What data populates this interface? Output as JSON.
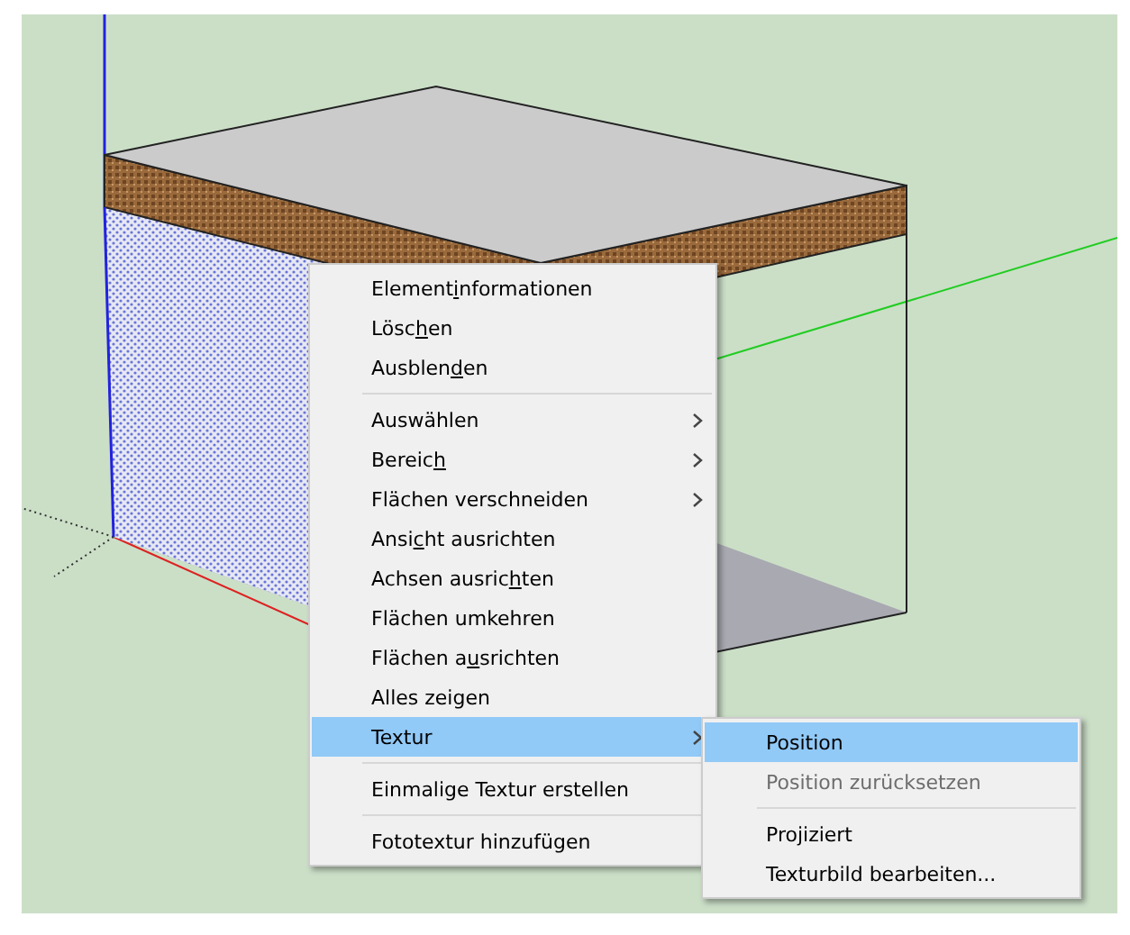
{
  "context_menu": {
    "items": [
      {
        "kind": "item",
        "label_before": "Element",
        "access_key": "i",
        "label_after": "nformationen",
        "has_submenu": false,
        "selected": false
      },
      {
        "kind": "item",
        "label_before": "Lösc",
        "access_key": "h",
        "label_after": "en",
        "has_submenu": false,
        "selected": false
      },
      {
        "kind": "item",
        "label_before": "Ausblen",
        "access_key": "d",
        "label_after": "en",
        "has_submenu": false,
        "selected": false
      },
      {
        "kind": "separator"
      },
      {
        "kind": "item",
        "label": "Auswählen",
        "has_submenu": true,
        "selected": false
      },
      {
        "kind": "item",
        "label_before": "Bereic",
        "access_key": "h",
        "has_submenu": true,
        "selected": false
      },
      {
        "kind": "item",
        "label": "Flächen verschneiden",
        "has_submenu": true,
        "selected": false
      },
      {
        "kind": "item",
        "label_before": "Ansi",
        "access_key": "c",
        "label_after": "ht ausrichten",
        "has_submenu": false,
        "selected": false
      },
      {
        "kind": "item",
        "label_before": "Achsen ausric",
        "access_key": "h",
        "label_after": "ten",
        "has_submenu": false,
        "selected": false
      },
      {
        "kind": "item",
        "label": "Flächen umkehren",
        "has_submenu": false,
        "selected": false
      },
      {
        "kind": "item",
        "label_before": "Flächen a",
        "access_key": "u",
        "label_after": "srichten",
        "has_submenu": false,
        "selected": false
      },
      {
        "kind": "item",
        "label": "Alles zeigen",
        "has_submenu": false,
        "selected": false
      },
      {
        "kind": "item",
        "label": "Textur",
        "has_submenu": true,
        "selected": true
      },
      {
        "kind": "separator"
      },
      {
        "kind": "item",
        "label": "Einmalige Textur erstellen",
        "has_submenu": false,
        "selected": false
      },
      {
        "kind": "separator"
      },
      {
        "kind": "item",
        "label": "Fototextur hinzufügen",
        "has_submenu": false,
        "selected": false
      }
    ]
  },
  "submenu": {
    "items": [
      {
        "kind": "item",
        "label": "Position",
        "disabled": false,
        "selected": true
      },
      {
        "kind": "item",
        "label": "Position zurücksetzen",
        "disabled": true,
        "selected": false
      },
      {
        "kind": "separator"
      },
      {
        "kind": "item",
        "label": "Projiziert",
        "disabled": false,
        "selected": false
      },
      {
        "kind": "item",
        "label": "Texturbild bearbeiten...",
        "disabled": false,
        "selected": false
      }
    ]
  }
}
